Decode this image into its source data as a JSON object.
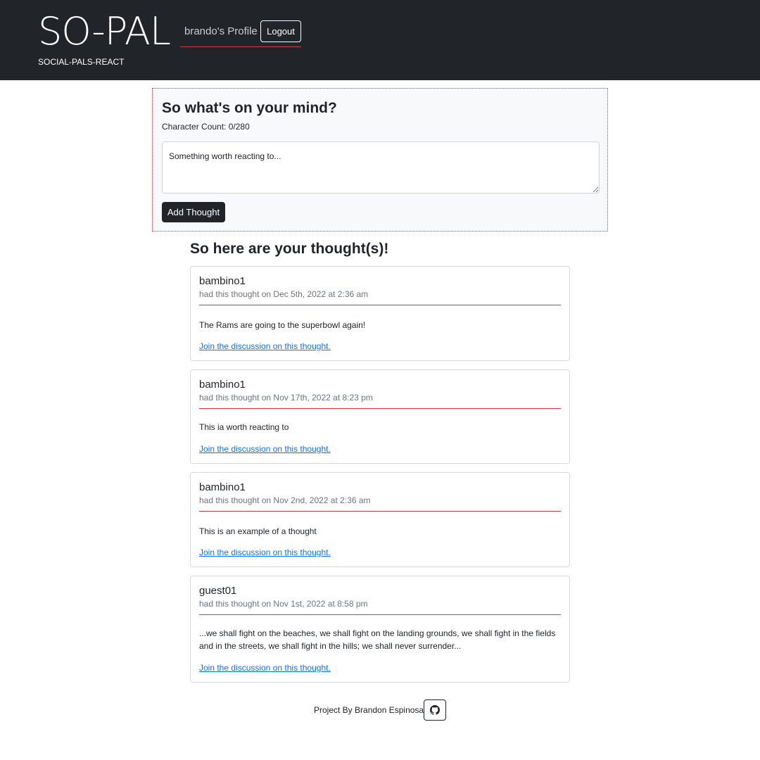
{
  "header": {
    "brand": "SO-PAL",
    "subtitle": "SOCIAL-PALS-REACT",
    "profile_label": "brando's Profile",
    "logout_label": "Logout"
  },
  "thought_form": {
    "title": "So what's on your mind?",
    "char_count": "Character Count: 0/280",
    "placeholder": "Something worth reacting to...",
    "value": "",
    "submit_label": "Add Thought"
  },
  "thoughts": {
    "heading": "So here are your thought(s)!",
    "items": [
      {
        "username": "bambino1",
        "date": "had this thought on Dec 5th, 2022 at 2:36 am",
        "text": "The Rams are going to the superbowl again!",
        "link": "Join the discussion on this thought."
      },
      {
        "username": "bambino1",
        "date": "had this thought on Nov 17th, 2022 at 8:23 pm",
        "text": "This ia worth reacting to",
        "link": "Join the discussion on this thought."
      },
      {
        "username": "bambino1",
        "date": "had this thought on Nov 2nd, 2022 at 2:36 am",
        "text": "This is an example of a thought",
        "link": "Join the discussion on this thought."
      },
      {
        "username": "guest01",
        "date": "had this thought on Nov 1st, 2022 at 8:58 pm",
        "text": "...we shall fight on the beaches, we shall fight on the landing grounds, we shall fight in the fields and in the streets, we shall fight in the hills; we shall never surrender...",
        "link": "Join the discussion on this thought."
      }
    ]
  },
  "footer": {
    "credit": "Project By Brandon Espinosa",
    "github_icon": "github-icon"
  },
  "colors": {
    "header_bg": "#212529",
    "accent_red": "#dc3545",
    "link_blue": "#0d6efd",
    "form_bg": "#f8f9fa",
    "muted_text": "#6c757d"
  }
}
